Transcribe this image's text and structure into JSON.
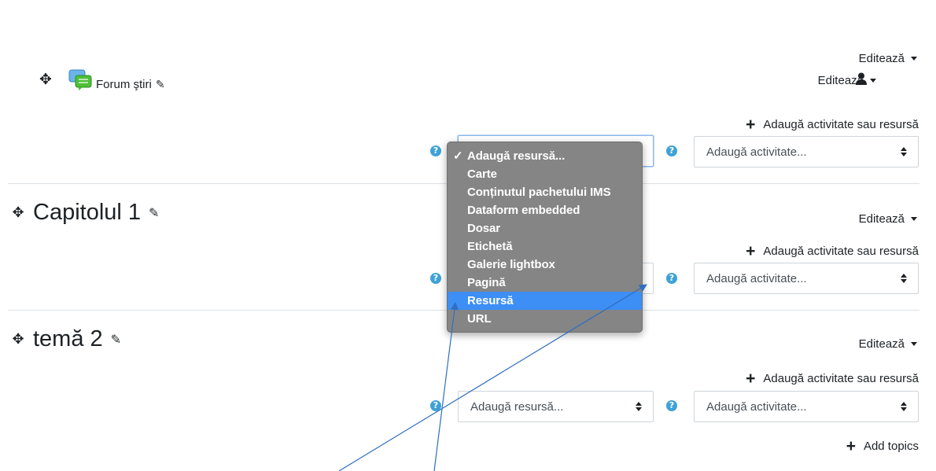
{
  "top": {
    "edit_label": "Editează",
    "edit_label_2": "Editează",
    "forum_label": "Forum ştiri"
  },
  "section0": {
    "add_activity_label": "Adaugă activitate sau resursă",
    "resource_select_value": "",
    "activity_select_value": "Adaugă activitate..."
  },
  "section1": {
    "title": "Capitolul 1",
    "edit_label": "Editează",
    "add_activity_label": "Adaugă activitate sau resursă",
    "activity_select_value": "Adaugă activitate..."
  },
  "section2": {
    "title": "temă 2",
    "edit_label": "Editează",
    "add_activity_label": "Adaugă activitate sau resursă",
    "resource_select_value": "Adaugă resursă...",
    "activity_select_value": "Adaugă activitate..."
  },
  "add_topics_label": "Add topics",
  "dropdown": {
    "items": [
      {
        "label": "Adaugă resursă...",
        "checked": true
      },
      {
        "label": "Carte"
      },
      {
        "label": "Conținutul pachetului IMS"
      },
      {
        "label": "Dataform embedded"
      },
      {
        "label": "Dosar"
      },
      {
        "label": "Etichetă"
      },
      {
        "label": "Galerie lightbox"
      },
      {
        "label": "Pagină"
      },
      {
        "label": "Resursă",
        "highlighted": true
      },
      {
        "label": "URL"
      }
    ]
  },
  "icons": {
    "help": "question-circle-icon",
    "move": "move-arrows-icon",
    "edit": "pencil-icon",
    "user": "user-icon",
    "forum": "forum-chat-icon",
    "add": "plus-icon"
  },
  "colors": {
    "help_icon": "#3fa2d6",
    "dropdown_bg": "#858585",
    "dropdown_highlight": "#3d8ef5",
    "annotation_arrow": "#2f6fbf"
  }
}
